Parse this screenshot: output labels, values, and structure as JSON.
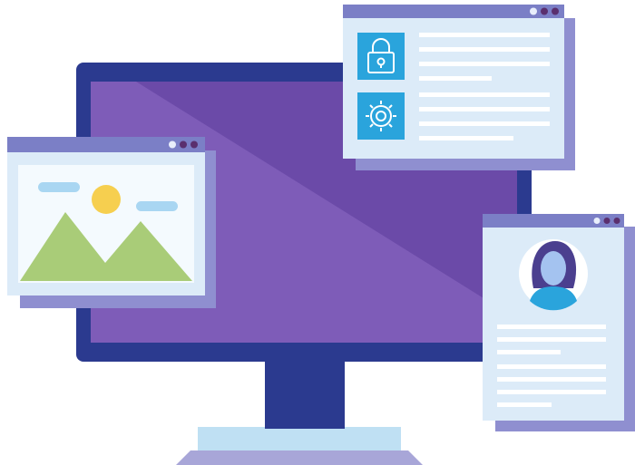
{
  "scene": {
    "description_icons": [
      "monitor-icon",
      "image-window-icon",
      "security-settings-window-icon",
      "profile-card-icon",
      "padlock-icon",
      "gear-icon",
      "user-avatar-icon",
      "mountain-icon",
      "sun-icon"
    ]
  },
  "colors": {
    "monitor_frame": "#2b3a8f",
    "screen_dark": "#6b4aa8",
    "screen_light": "#7e5cb8",
    "stand": "#2b3a8f",
    "base_top": "#bfe0f3",
    "base_shadow": "#a8a6d8",
    "window_bar": "#7b7fc6",
    "window_bg": "#dcebf8",
    "window_shadow": "#8f8fd0",
    "window_border": "#c8dff2",
    "icon_tile": "#2aa4dc",
    "text_line": "#ffffff",
    "image_pane": "#f4fafe",
    "mountain": "#a9cc78",
    "sun": "#f6cf4f",
    "cloud": "#a9d6f2",
    "dot_light": "#e8eefb",
    "dot_dark": "#5a2f6e",
    "avatar_hair": "#4b3f8f",
    "avatar_skin": "#a4c3f0",
    "avatar_body": "#2aa4dc"
  }
}
